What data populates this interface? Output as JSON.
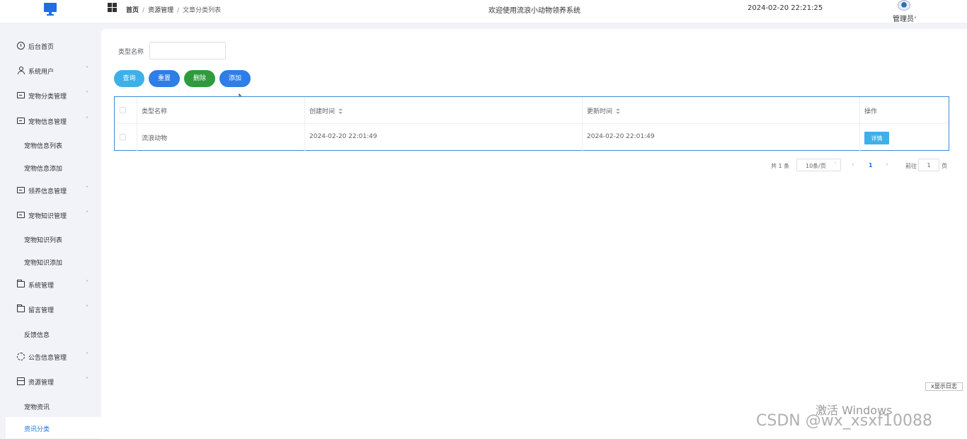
{
  "header": {
    "breadcrumb": [
      "首页",
      "资源管理",
      "文章分类列表"
    ],
    "breadcrumb_sep": "/",
    "app_title": "欢迎使用流浪小动物领养系统",
    "datetime": "2024-02-20 22:21:25",
    "user_label": "管理员",
    "user_caret": "˅"
  },
  "sidebar": {
    "items": [
      {
        "label": "后台首页",
        "icon": "clock-icon",
        "chevron": ""
      },
      {
        "label": "系统用户",
        "icon": "user-icon",
        "chevron": "˅"
      },
      {
        "label": "宠物分类管理",
        "icon": "card-icon",
        "chevron": "˅"
      },
      {
        "label": "宠物信息管理",
        "icon": "card-icon",
        "chevron": "˄"
      },
      {
        "label": "宠物信息列表"
      },
      {
        "label": "宠物信息添加"
      },
      {
        "label": "领养信息管理",
        "icon": "card-icon",
        "chevron": "˅"
      },
      {
        "label": "宠物知识管理",
        "icon": "card-icon",
        "chevron": "˄"
      },
      {
        "label": "宠物知识列表"
      },
      {
        "label": "宠物知识添加"
      },
      {
        "label": "系统管理",
        "icon": "folder-icon",
        "chevron": "˅"
      },
      {
        "label": "留言管理",
        "icon": "folder-icon",
        "chevron": "˄"
      },
      {
        "label": "反馈信息"
      },
      {
        "label": "公告信息管理",
        "icon": "sun-icon",
        "chevron": "˅"
      },
      {
        "label": "资源管理",
        "icon": "box-icon",
        "chevron": "˄"
      },
      {
        "label": "宠物资讯"
      },
      {
        "label": "资讯分类",
        "active": true
      }
    ]
  },
  "search": {
    "label": "类型名称",
    "value": "",
    "placeholder": ""
  },
  "buttons": {
    "query": "查询",
    "reset": "重置",
    "delete": "删除",
    "add": "添加"
  },
  "table": {
    "columns": [
      "类型名称",
      "创建时间",
      "更新时间",
      "操作"
    ],
    "rows": [
      {
        "name": "流浪动物",
        "created": "2024-02-20 22:01:49",
        "updated": "2024-02-20 22:01:49",
        "action": "详情"
      }
    ]
  },
  "pagination": {
    "total": "共 1 条",
    "page_size": "10条/页",
    "current_page": "1",
    "goto_label": "前往",
    "goto_value": "1",
    "page_suffix": "页",
    "prev": "‹",
    "next": "›"
  },
  "overlay": {
    "log_button": "x显示日志",
    "windows_watermark": "激活 Windows",
    "csdn_watermark": "CSDN @wx_xsxf10088"
  },
  "colors": {
    "primary": "#2d7ee8",
    "info": "#3db0e8",
    "success": "#2e9b3f",
    "active_text": "#1e6fe0"
  }
}
